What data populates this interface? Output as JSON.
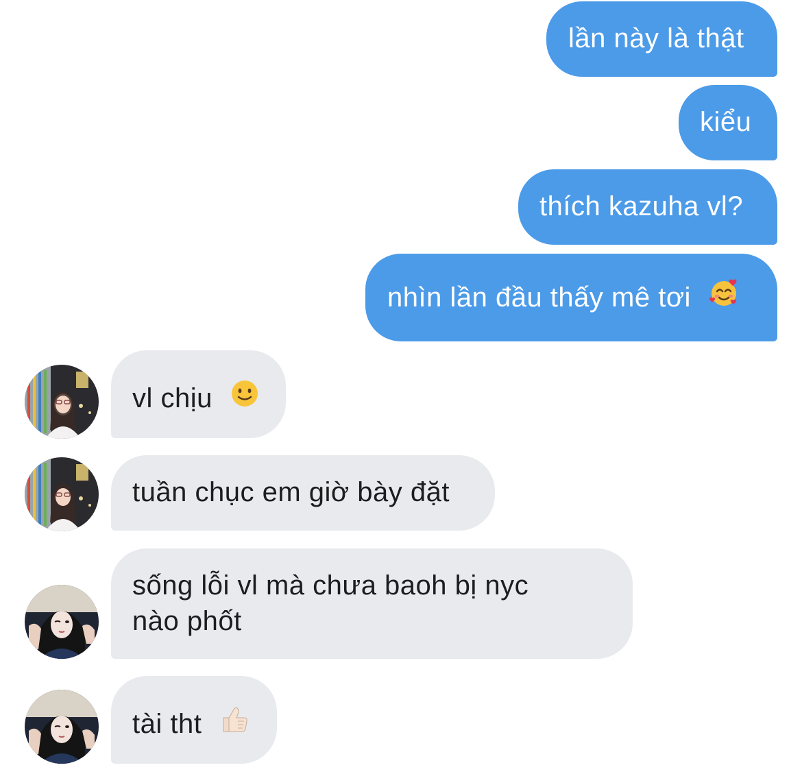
{
  "conversation": {
    "sent": [
      {
        "text": "lần này là thật"
      },
      {
        "text": "kiểu"
      },
      {
        "text": "thích kazuha vl?"
      },
      {
        "text": "nhìn lần đầu thấy mê tơi",
        "emoji": "smiling-face-with-hearts-emoji"
      }
    ],
    "received": [
      {
        "text": "vl chịu",
        "emoji": "slightly-smiling-face-emoji",
        "avatar": "avatar-girl-street"
      },
      {
        "text": "tuần chục em giờ bày đặt",
        "avatar": "avatar-girl-street"
      },
      {
        "text": "sống lỗi vl mà chưa baoh bị nyc nào phốt",
        "avatar": "avatar-girl-wink"
      },
      {
        "text": "tài tht",
        "emoji": "thumbs-up-emoji",
        "avatar": "avatar-girl-wink"
      }
    ]
  },
  "colors": {
    "sent_bubble": "#4c9be8",
    "sent_text": "#ffffff",
    "received_bubble": "#e8eaee",
    "received_text": "#1d1d1f"
  }
}
